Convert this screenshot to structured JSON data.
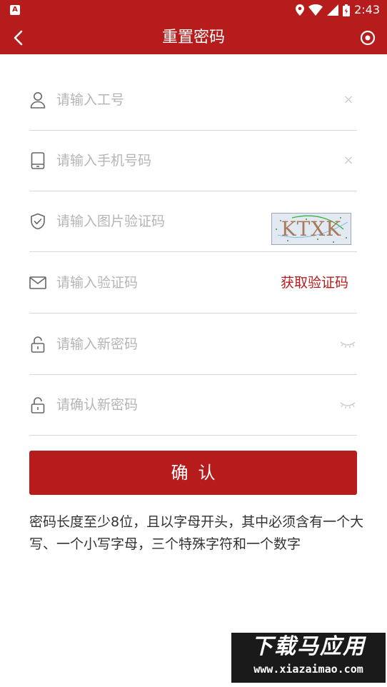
{
  "status_bar": {
    "app_badge": "A",
    "time": "2:43"
  },
  "header": {
    "title": "重置密码"
  },
  "form": {
    "employee_id": {
      "placeholder": "请输入工号",
      "value": ""
    },
    "phone": {
      "placeholder": "请输入手机号码",
      "value": ""
    },
    "image_captcha": {
      "placeholder": "请输入图片验证码",
      "value": "",
      "captcha_text": "KTXK"
    },
    "sms_code": {
      "placeholder": "请输入验证码",
      "value": "",
      "get_code_label": "获取验证码"
    },
    "new_password": {
      "placeholder": "请输入新密码",
      "value": ""
    },
    "confirm_password": {
      "placeholder": "请确认新密码",
      "value": ""
    },
    "clear_symbol": "×"
  },
  "actions": {
    "confirm_label": "确认"
  },
  "rules": {
    "text": "密码长度至少8位，且以字母开头，其中必须含有一个大写、一个小写字母，三个特殊字符和一个数字"
  },
  "watermark": {
    "cn": "下载马应用",
    "url": "www.xiazaimao.com"
  },
  "colors": {
    "primary": "#b71c1c",
    "placeholder": "#b5b5b5",
    "divider": "#d8d8d8"
  }
}
